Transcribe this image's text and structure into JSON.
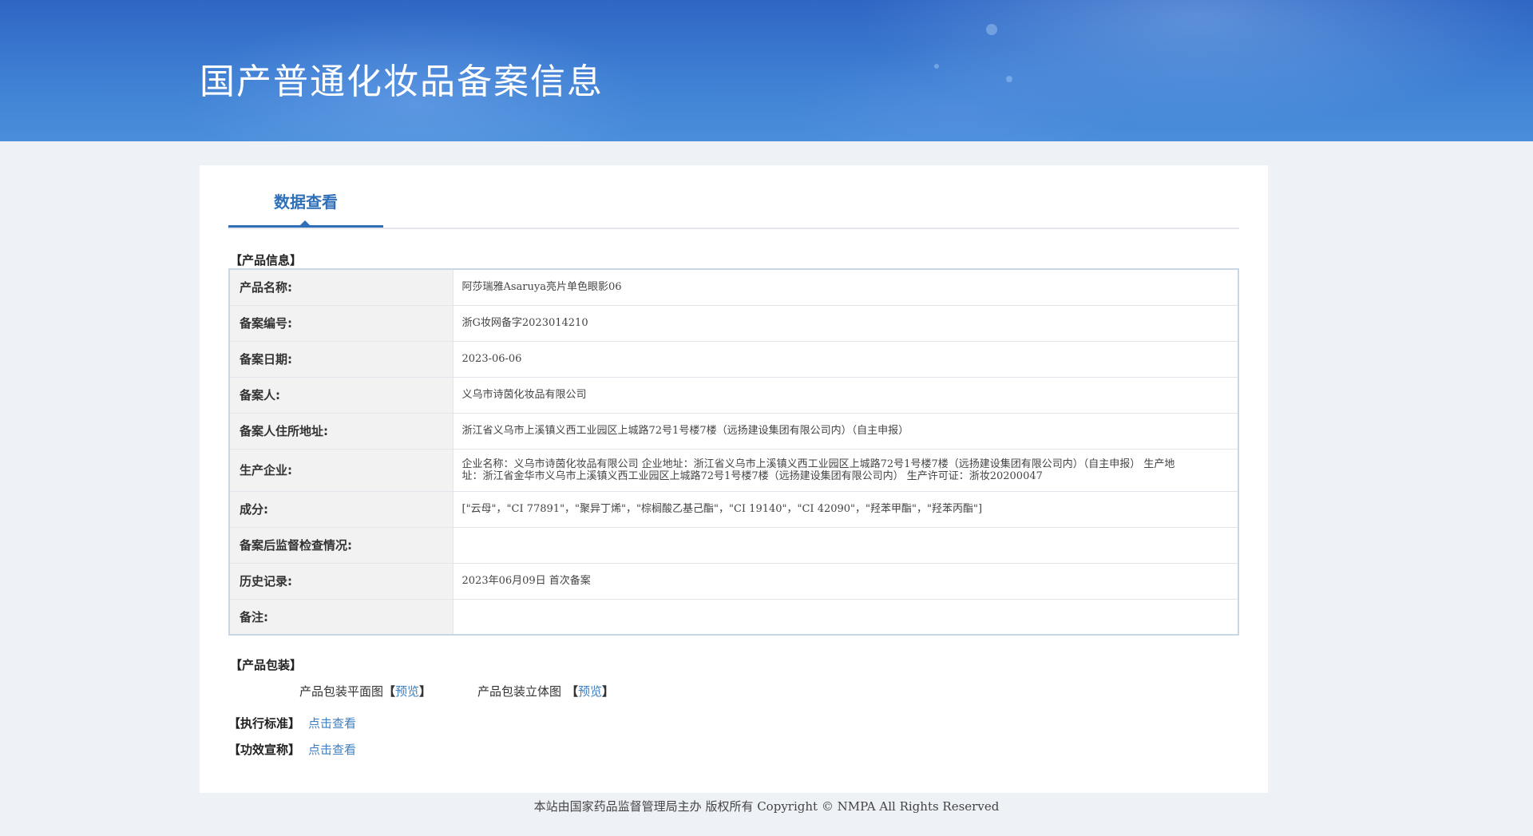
{
  "header": {
    "title": "国产普通化妆品备案信息"
  },
  "tabs": {
    "active_label": "数据查看"
  },
  "product_info": {
    "section_title": "【产品信息】",
    "rows": [
      {
        "label": "产品名称:",
        "value": "阿莎瑞雅Asaruya亮片单色眼影06"
      },
      {
        "label": "备案编号:",
        "value": "浙G妆网备字2023014210"
      },
      {
        "label": "备案日期:",
        "value": "2023-06-06"
      },
      {
        "label": "备案人:",
        "value": "义乌市诗茵化妆品有限公司"
      },
      {
        "label": "备案人住所地址:",
        "value": "浙江省义乌市上溪镇义西工业园区上城路72号1号楼7楼（远扬建设集团有限公司内）（自主申报）"
      },
      {
        "label": "生产企业:",
        "value": "企业名称：义乌市诗茵化妆品有限公司 企业地址：浙江省义乌市上溪镇义西工业园区上城路72号1号楼7楼（远扬建设集团有限公司内）（自主申报） 生产地址：浙江省金华市义乌市上溪镇义西工业园区上城路72号1号楼7楼（远扬建设集团有限公司内） 生产许可证：浙妆20200047"
      },
      {
        "label": "成分:",
        "value": "[\"云母\"，\"CI 77891\"，\"聚异丁烯\"，\"棕榈酸乙基己酯\"，\"CI 19140\"，\"CI 42090\"，\"羟苯甲酯\"，\"羟苯丙酯\"]"
      },
      {
        "label": "备案后监督检查情况:",
        "value": ""
      },
      {
        "label": "历史记录:",
        "value": "2023年06月09日 首次备案"
      },
      {
        "label": "备注:",
        "value": ""
      }
    ]
  },
  "packaging": {
    "section_title": "【产品包装】",
    "flat_label": "产品包装平面图",
    "three_d_label": "产品包装立体图",
    "bracket_open": "【",
    "bracket_close": "】",
    "preview_label": "预览"
  },
  "standard": {
    "label": "【执行标准】",
    "link": "点击查看"
  },
  "efficacy": {
    "label": "【功效宣称】",
    "link": "点击查看"
  },
  "footer": {
    "text": "本站由国家药品监督管理局主办 版权所有 Copyright © NMPA All Rights Reserved"
  },
  "colors": {
    "banner": "#3e7fd3",
    "accent": "#2f6fb8",
    "link": "#3b7fc4",
    "page_bg": "#eef2f6"
  }
}
